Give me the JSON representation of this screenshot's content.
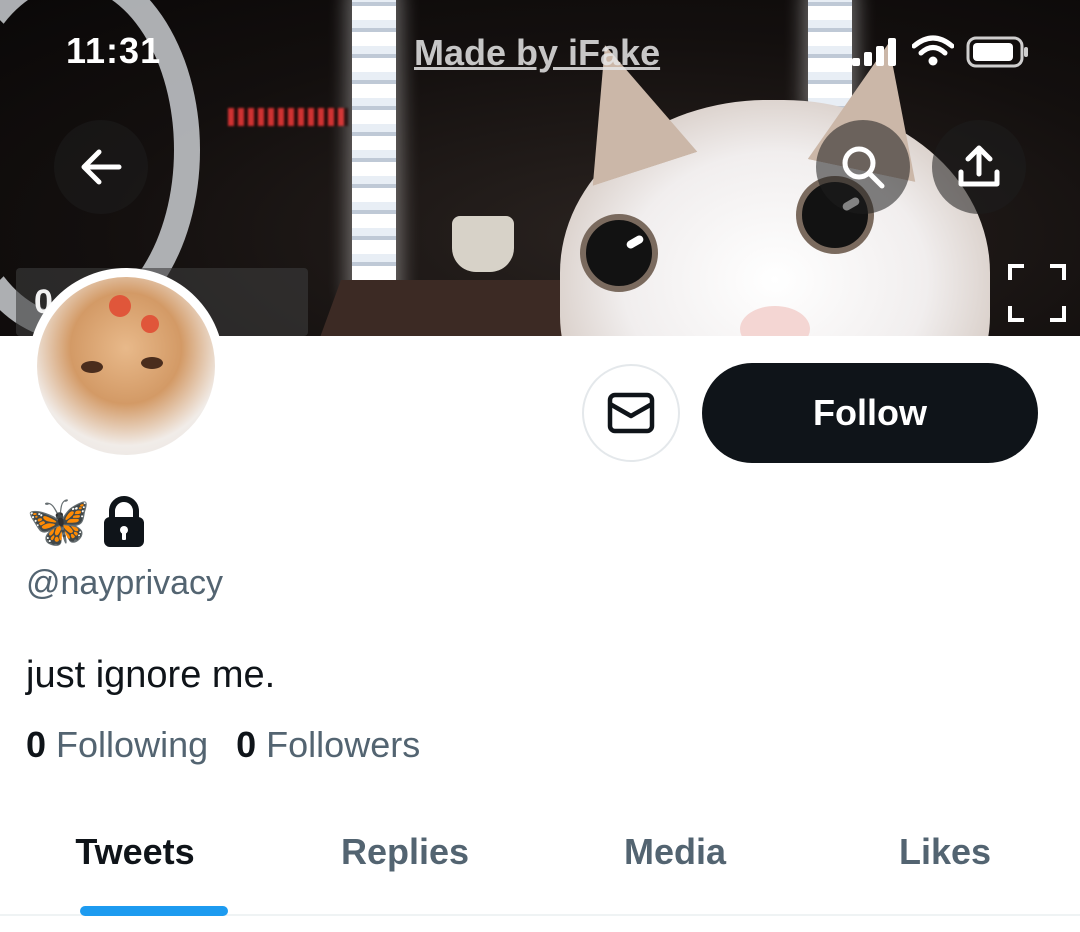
{
  "status_bar": {
    "time": "11:31",
    "watermark": "Made by iFake"
  },
  "banner": {
    "timestamp": "0     2 AM"
  },
  "profile": {
    "display_name_icons": [
      "butterfly-emoji",
      "lock-icon"
    ],
    "butterfly": "🦋",
    "handle": "@nayprivacy",
    "bio": "just ignore me.",
    "following_count": "0",
    "following_label": "Following",
    "followers_count": "0",
    "followers_label": "Followers"
  },
  "actions": {
    "follow_label": "Follow"
  },
  "tabs": [
    {
      "label": "Tweets",
      "active": true
    },
    {
      "label": "Replies",
      "active": false
    },
    {
      "label": "Media",
      "active": false
    },
    {
      "label": "Likes",
      "active": false
    }
  ],
  "colors": {
    "accent": "#1d9bf0",
    "text_primary": "#0f1419",
    "text_secondary": "#536471",
    "follow_bg": "#0f1419"
  }
}
